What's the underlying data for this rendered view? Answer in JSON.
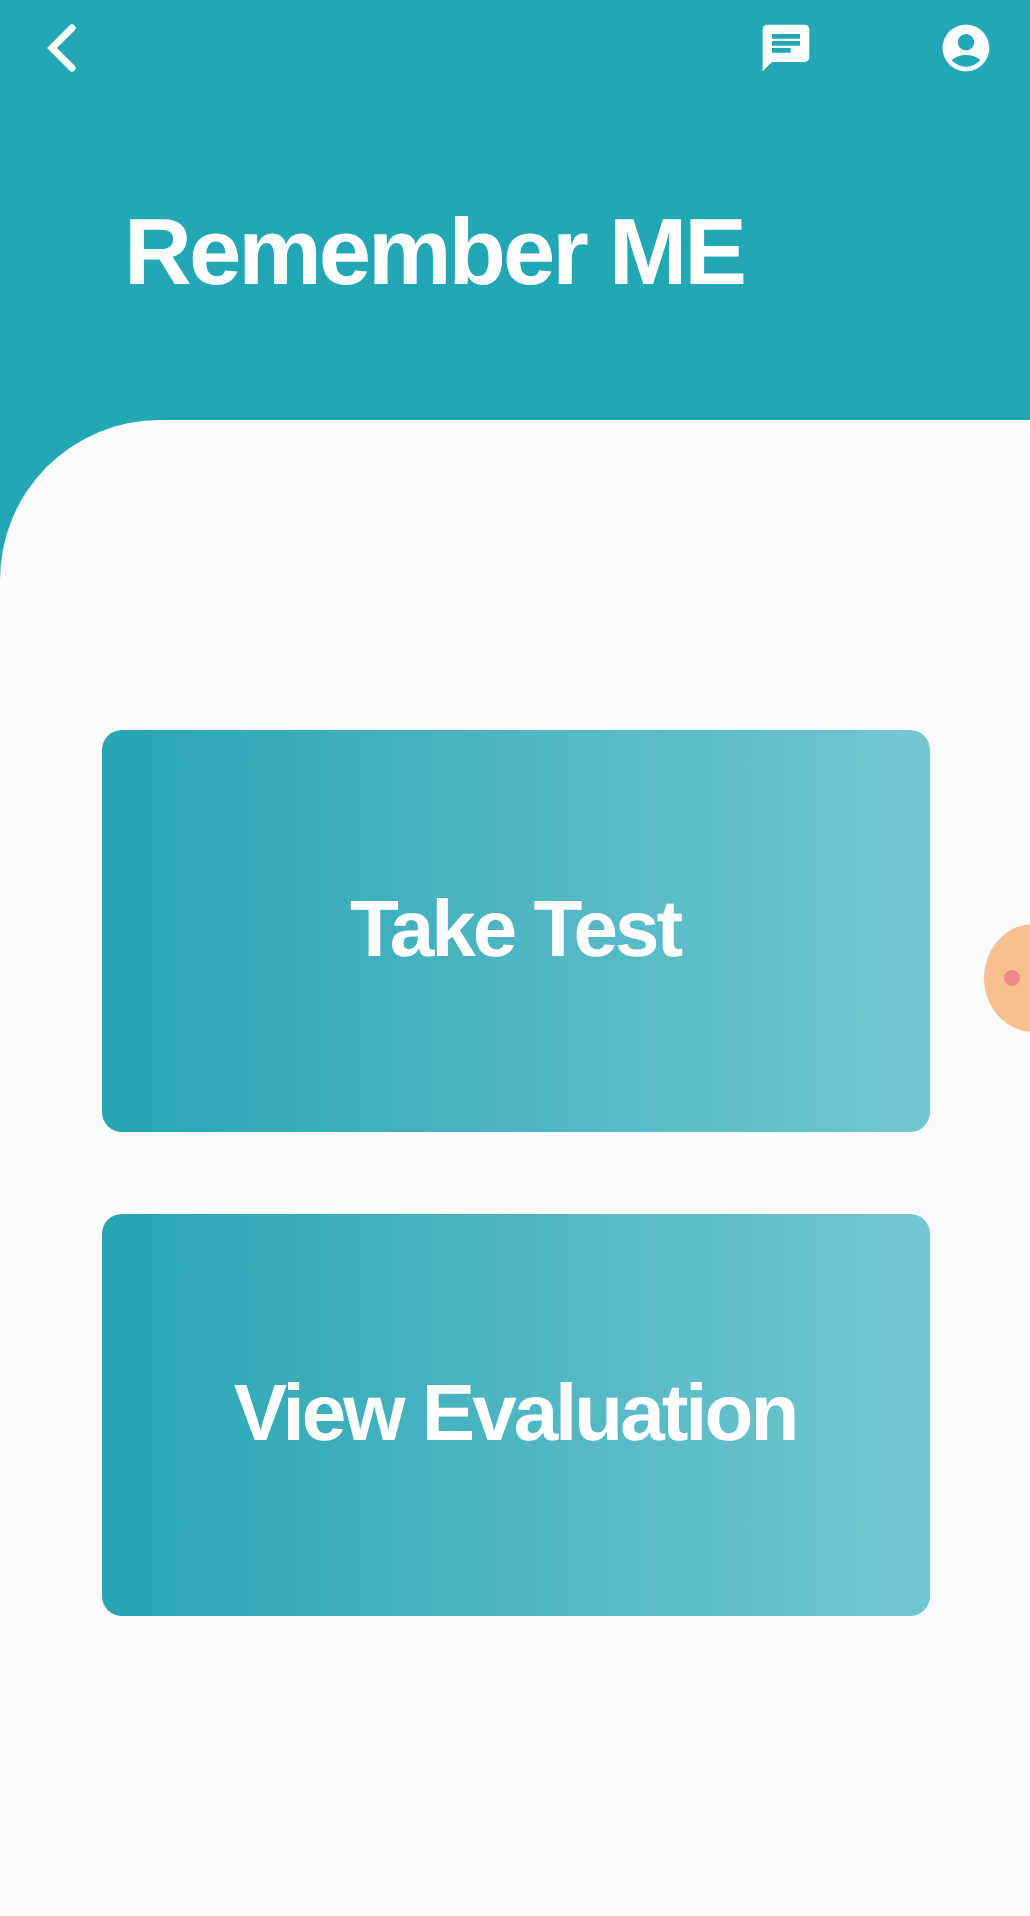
{
  "header": {
    "title": "Remember ME"
  },
  "buttons": [
    {
      "label": "Take Test"
    },
    {
      "label": "View Evaluation"
    }
  ]
}
